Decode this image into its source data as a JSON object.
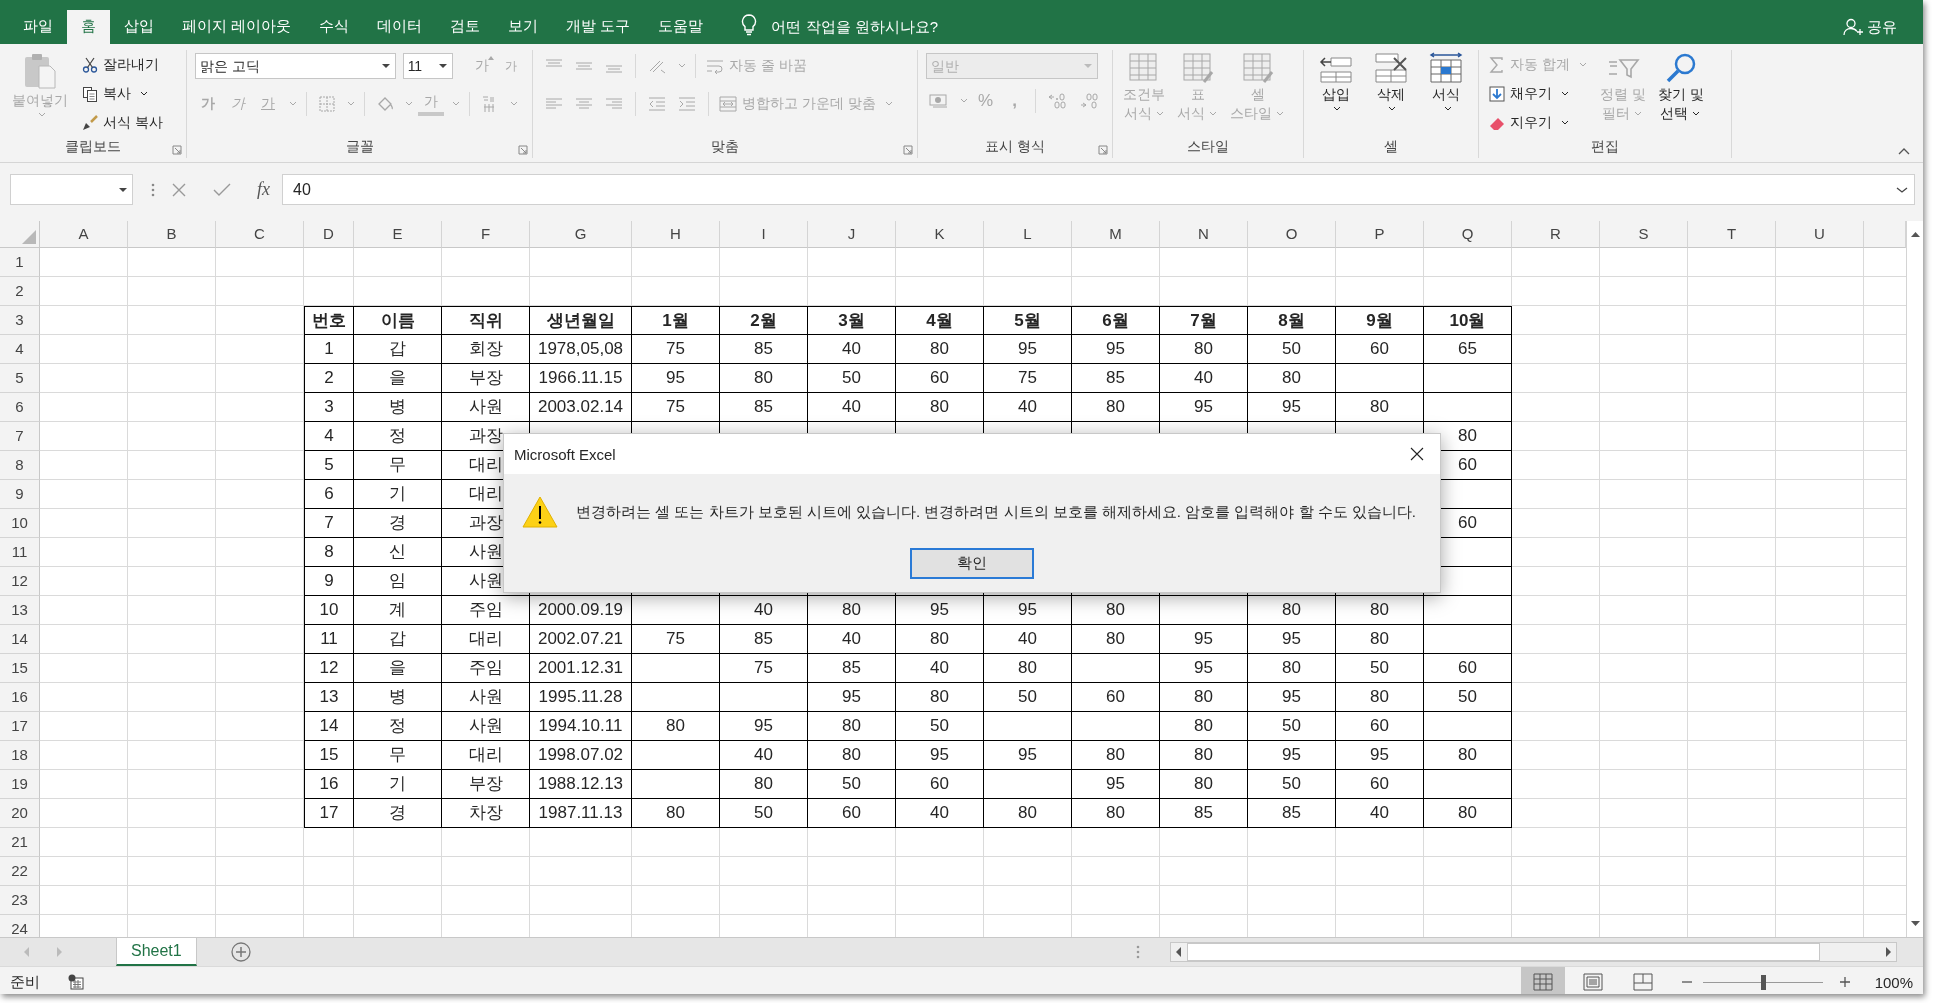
{
  "tabs": [
    {
      "label": "파일",
      "selected": false
    },
    {
      "label": "홈",
      "selected": true
    },
    {
      "label": "삽입",
      "selected": false
    },
    {
      "label": "페이지 레이아웃",
      "selected": false
    },
    {
      "label": "수식",
      "selected": false
    },
    {
      "label": "데이터",
      "selected": false
    },
    {
      "label": "검토",
      "selected": false
    },
    {
      "label": "보기",
      "selected": false
    },
    {
      "label": "개발 도구",
      "selected": false
    },
    {
      "label": "도움말",
      "selected": false
    }
  ],
  "tell_me": "어떤 작업을 원하시나요?",
  "share": "공유",
  "ribbon": {
    "groups": [
      {
        "label": "클립보드",
        "items": [
          {
            "label": "붙여넣기",
            "disabled": true
          },
          {
            "label": "잘라내기",
            "disabled": false
          },
          {
            "label": "복사",
            "disabled": false
          },
          {
            "label": "서식 복사",
            "disabled": false
          }
        ]
      },
      {
        "label": "글꼴",
        "font_name": "맑은 고딕",
        "font_size": "11",
        "glyphs": [
          "가",
          "가",
          "가",
          "가",
          "가",
          "가"
        ],
        "disabled": true
      },
      {
        "label": "맞춤",
        "items": [
          {
            "label": "자동 줄 바꿈"
          },
          {
            "label": "병합하고 가운데 맞춤"
          }
        ],
        "disabled": true
      },
      {
        "label": "표시 형식",
        "format": "일반",
        "symbols": [
          "%",
          ","
        ],
        "disabled": true
      },
      {
        "label": "스타일",
        "items": [
          {
            "lines": [
              "조건부",
              "서식"
            ]
          },
          {
            "lines": [
              "표",
              "서식"
            ]
          },
          {
            "lines": [
              "셀",
              "스타일"
            ]
          }
        ],
        "disabled": true
      },
      {
        "label": "셀",
        "items": [
          {
            "label": "삽입",
            "disabled": false
          },
          {
            "label": "삭제",
            "disabled": false
          },
          {
            "label": "서식",
            "disabled": false
          }
        ]
      },
      {
        "label": "편집",
        "items": [
          {
            "lines": [
              "자동 합계"
            ],
            "disabled": true
          },
          {
            "lines": [
              "채우기"
            ],
            "disabled": false
          },
          {
            "lines": [
              "지우기"
            ],
            "disabled": false
          },
          {
            "lines": [
              "정렬 및",
              "필터"
            ],
            "disabled": true
          },
          {
            "lines": [
              "찾기 및",
              "선택"
            ],
            "disabled": false
          }
        ]
      }
    ]
  },
  "formula_bar": {
    "function_label": "fx",
    "value": "40"
  },
  "sheet": {
    "columns": [
      "A",
      "B",
      "C",
      "D",
      "E",
      "F",
      "G",
      "H",
      "I",
      "J",
      "K",
      "L",
      "M",
      "N",
      "O",
      "P",
      "Q",
      "R",
      "S",
      "T",
      "U"
    ],
    "row_numbers": [
      "1",
      "2",
      "3",
      "4",
      "5",
      "6",
      "7",
      "8",
      "9",
      "10",
      "11",
      "12",
      "13",
      "14",
      "15",
      "16",
      "17",
      "18",
      "19",
      "20",
      "21",
      "22",
      "23",
      "24"
    ],
    "table": {
      "header": [
        "번호",
        "이름",
        "직위",
        "생년월일",
        "1월",
        "2월",
        "3월",
        "4월",
        "5월",
        "6월",
        "7월",
        "8월",
        "9월",
        "10월"
      ],
      "rows": [
        [
          "1",
          "갑",
          "회장",
          "1978,05,08",
          "75",
          "85",
          "40",
          "80",
          "95",
          "95",
          "80",
          "50",
          "60",
          "65"
        ],
        [
          "2",
          "을",
          "부장",
          "1966.11.15",
          "95",
          "80",
          "50",
          "60",
          "75",
          "85",
          "40",
          "80",
          null,
          null
        ],
        [
          "3",
          "병",
          "사원",
          "2003.02.14",
          "75",
          "85",
          "40",
          "80",
          "40",
          "80",
          "95",
          "95",
          "80",
          null
        ],
        [
          "4",
          "정",
          "과장",
          null,
          null,
          null,
          null,
          null,
          null,
          null,
          null,
          null,
          null,
          "80"
        ],
        [
          "5",
          "무",
          "대리",
          null,
          null,
          null,
          null,
          null,
          null,
          null,
          null,
          null,
          null,
          "60"
        ],
        [
          "6",
          "기",
          "대리",
          null,
          null,
          null,
          null,
          null,
          null,
          null,
          null,
          null,
          null,
          null
        ],
        [
          "7",
          "경",
          "과장",
          null,
          null,
          null,
          null,
          null,
          null,
          null,
          null,
          null,
          null,
          "60"
        ],
        [
          "8",
          "신",
          "사원",
          null,
          null,
          null,
          null,
          null,
          null,
          null,
          null,
          null,
          null,
          null
        ],
        [
          "9",
          "임",
          "사원",
          null,
          null,
          null,
          null,
          null,
          null,
          null,
          null,
          null,
          null,
          null
        ],
        [
          "10",
          "계",
          "주임",
          "2000.09.19",
          null,
          "40",
          "80",
          "95",
          "95",
          "80",
          null,
          "80",
          "80",
          null
        ],
        [
          "11",
          "갑",
          "대리",
          "2002.07.21",
          "75",
          "85",
          "40",
          "80",
          "40",
          "80",
          "95",
          "95",
          "80",
          null
        ],
        [
          "12",
          "을",
          "주임",
          "2001.12.31",
          null,
          "75",
          "85",
          "40",
          "80",
          null,
          "95",
          "80",
          "50",
          "60"
        ],
        [
          "13",
          "병",
          "사원",
          "1995.11.28",
          null,
          null,
          "95",
          "80",
          "50",
          "60",
          "80",
          "95",
          "80",
          "50"
        ],
        [
          "14",
          "정",
          "사원",
          "1994.10.11",
          "80",
          "95",
          "80",
          "50",
          null,
          null,
          "80",
          "50",
          "60",
          null
        ],
        [
          "15",
          "무",
          "대리",
          "1998.07.02",
          null,
          "40",
          "80",
          "95",
          "95",
          "80",
          "80",
          "95",
          "95",
          "80"
        ],
        [
          "16",
          "기",
          "부장",
          "1988.12.13",
          null,
          "80",
          "50",
          "60",
          null,
          "95",
          "80",
          "50",
          "60",
          null
        ],
        [
          "17",
          "경",
          "차장",
          "1987.11.13",
          "80",
          "50",
          "60",
          "40",
          "80",
          "80",
          "85",
          "85",
          "40",
          "80"
        ]
      ]
    }
  },
  "sheet_tabs": [
    {
      "label": "Sheet1",
      "selected": true
    }
  ],
  "status_bar": {
    "status": "준비",
    "views": [
      {
        "kind": "normal",
        "selected": true
      },
      {
        "kind": "page_layout",
        "selected": false
      },
      {
        "kind": "page_break",
        "selected": false
      }
    ],
    "zoom": {
      "level": 0.5,
      "reading": "100%"
    }
  },
  "dialog": {
    "title": "Microsoft Excel",
    "message": "변경하려는 셀 또는 차트가 보호된 시트에 있습니다. 변경하려면 시트의 보호를 해제하세요. 암호를 입력해야 할 수도 있습니다.",
    "button": "확인"
  }
}
